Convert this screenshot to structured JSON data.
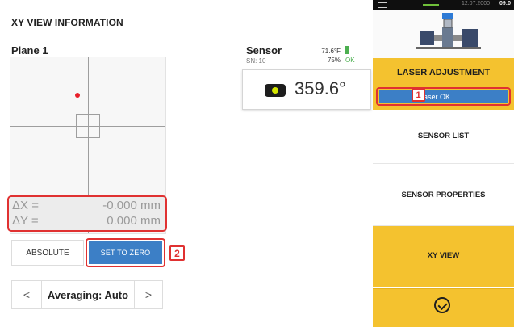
{
  "header": {
    "title": "XY VIEW INFORMATION"
  },
  "plot": {
    "plane_label": "Plane 1"
  },
  "deltas": {
    "dx_label": "ΔX =",
    "dx_value": "-0.000 mm",
    "dy_label": "ΔY =",
    "dy_value": "0.000 mm"
  },
  "buttons": {
    "absolute": "ABSOLUTE",
    "set_to_zero": "SET TO ZERO"
  },
  "averaging": {
    "label": "Averaging: Auto",
    "prev": "<",
    "next": ">"
  },
  "sensor": {
    "title": "Sensor",
    "serial": "SN: 10",
    "temperature": "71.6°F",
    "battery": "75%",
    "ok": "OK",
    "angle": "359.6°"
  },
  "status_bar": {
    "date": "12.07.2000",
    "time": "09:0"
  },
  "menu": {
    "laser_adjustment": "LASER ADJUSTMENT",
    "laser_ok": "Laser OK",
    "sensor_list": "SENSOR LIST",
    "sensor_properties": "SENSOR PROPERTIES",
    "xy_view": "XY VIEW"
  },
  "callouts": {
    "one": "1",
    "two": "2"
  },
  "colors": {
    "accent_yellow": "#f4c22f",
    "accent_blue": "#3c7fc6",
    "highlight_red": "#e03131",
    "target_red": "#e8202a"
  },
  "icons": [
    "sensor-icon",
    "machine-illustration",
    "check-circle-icon",
    "battery-icon"
  ]
}
